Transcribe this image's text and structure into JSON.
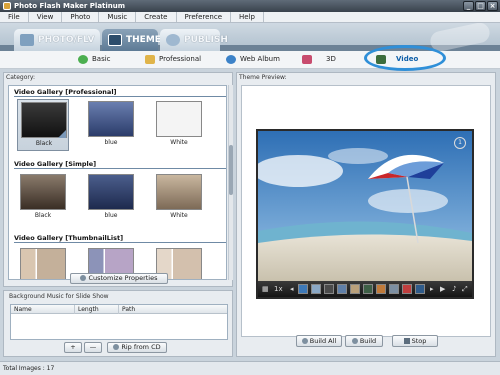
{
  "window": {
    "title": "Photo Flash Maker Platinum",
    "min": "_",
    "max": "□",
    "close": "×"
  },
  "menu": [
    "File",
    "View",
    "Photo",
    "Music",
    "Create",
    "Preference",
    "Help"
  ],
  "main_tabs": {
    "photo": "Photo/FLV",
    "theme": "Theme",
    "publish": "Publish"
  },
  "sub_tabs": {
    "basic": "Basic",
    "professional": "Professional",
    "web_album": "Web Album",
    "three_d": "3D",
    "video": "Video"
  },
  "left": {
    "category_label": "Category:",
    "groups": [
      {
        "title": "Video Gallery [Professional]",
        "items": [
          {
            "label": "Black"
          },
          {
            "label": "blue"
          },
          {
            "label": "White"
          }
        ]
      },
      {
        "title": "Video Gallery [Simple]",
        "items": [
          {
            "label": "Black"
          },
          {
            "label": "blue"
          },
          {
            "label": "White"
          }
        ]
      },
      {
        "title": "Video Gallery [ThumbnailList]",
        "items": [
          {
            "label": ""
          },
          {
            "label": ""
          },
          {
            "label": ""
          }
        ]
      }
    ],
    "customize_button": "Customize Properties"
  },
  "music": {
    "label": "Background Music for Slide Show",
    "columns": [
      "Name",
      "Length",
      "Path"
    ],
    "add": "+",
    "remove": "—",
    "rip": "Rip from CD"
  },
  "preview": {
    "label": "Theme Preview:",
    "page_indicator": "1",
    "build_all": "Build All",
    "build": "Build",
    "stop": "Stop"
  },
  "status": {
    "text": "Total Images : 17"
  },
  "colors": {
    "accent": "#2f8fd8",
    "theme_tab": "#6f8aa5"
  }
}
